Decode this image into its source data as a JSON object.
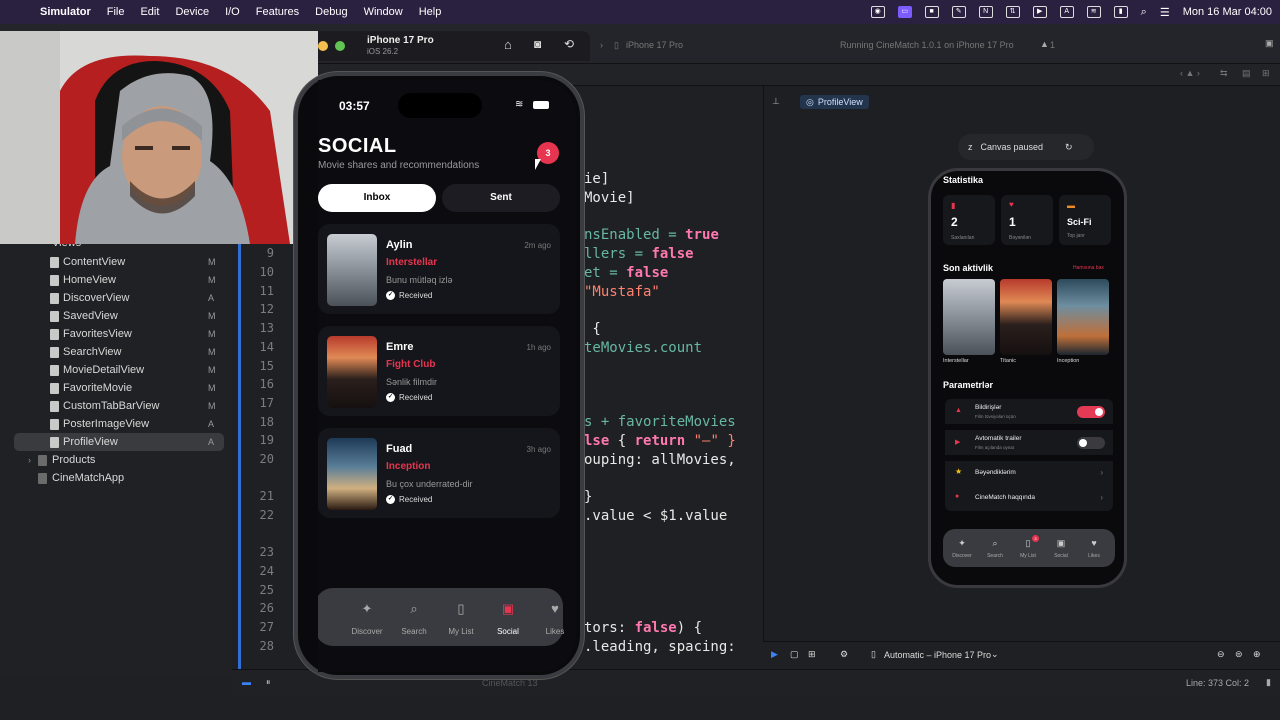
{
  "menubar": {
    "app": "Simulator",
    "items": [
      "File",
      "Edit",
      "Device",
      "I/O",
      "Features",
      "Debug",
      "Window",
      "Help"
    ],
    "clock": "Mon 16 Mar  04:00"
  },
  "simulator": {
    "device": "iPhone 17 Pro",
    "os": "iOS 26.2"
  },
  "toolbar": {
    "scheme_device": "iPhone 17 Pro",
    "status": "Running CineMatch 1.0.1 on iPhone 17 Pro",
    "warnings": "1"
  },
  "navigator": {
    "group": "Views",
    "files": [
      {
        "name": "ContentView",
        "badge": "M"
      },
      {
        "name": "HomeView",
        "badge": "M"
      },
      {
        "name": "DiscoverView",
        "badge": "A"
      },
      {
        "name": "SavedView",
        "badge": "M"
      },
      {
        "name": "FavoritesView",
        "badge": "M"
      },
      {
        "name": "SearchView",
        "badge": "M"
      },
      {
        "name": "MovieDetailView",
        "badge": "M"
      },
      {
        "name": "FavoriteMovie",
        "badge": "M"
      },
      {
        "name": "CustomTabBarView",
        "badge": "M"
      },
      {
        "name": "PosterImageView",
        "badge": "A"
      },
      {
        "name": "ProfileView",
        "badge": "A"
      }
    ],
    "products": "Products",
    "app_folder": "CineMatchApp"
  },
  "editor": {
    "line_numbers": [
      "9",
      "10",
      "11",
      "12",
      "13",
      "14",
      "15",
      "16",
      "17",
      "18",
      "19",
      "20",
      "21",
      "22",
      "23",
      "24",
      "25",
      "26",
      "27",
      "28"
    ],
    "code": {
      "l1": "ie]",
      "l2": "Movie]",
      "l3a": "nsEnabled = ",
      "l3b": "true",
      "l4a": "llers = ",
      "l4b": "false",
      "l5a": "et = ",
      "l5b": "false",
      "l6": "\"Mustafa\"",
      "l7": " {",
      "l8": "teMovies.count",
      "l9a": "s + ",
      "l9b": "favoriteMovies",
      "l10a": "lse",
      "l10b": " { ",
      "l10c": "return",
      "l10d": " \"—\" }",
      "l11": "ouping: allMovies,",
      "l12": "}",
      "l13": ".value < $1.value",
      "l14a": "tors: ",
      "l14b": "false",
      "l14c": ") {",
      "l15": ".leading, spacing:"
    }
  },
  "canvas": {
    "tab": "ProfileView",
    "paused": "Canvas paused",
    "device_selector": "Automatic – iPhone 17 Pro"
  },
  "status": {
    "position": "Line: 373  Col: 2",
    "target": "CineMatch 13"
  },
  "preview": {
    "stats_title": "Statistika",
    "stats": [
      {
        "value": "2",
        "label": "Saxlanılan"
      },
      {
        "value": "1",
        "label": "Bəyənilən"
      },
      {
        "value": "Sci-Fi",
        "label": "Top janr"
      }
    ],
    "activity_title": "Son aktivlik",
    "activity_link": "Hamısına bax",
    "activity": [
      "Interstellar",
      "Titanic",
      "Inception"
    ],
    "settings_title": "Parametrlər",
    "settings": [
      {
        "title": "Bildirişlər",
        "sub": "Film tövsiyələri üçün",
        "toggle": true
      },
      {
        "title": "Avtomatik trailer",
        "sub": "Film açılanda oynat",
        "toggle": false
      },
      {
        "title": "Bəyəndiklərim"
      },
      {
        "title": "CineMatch haqqında"
      }
    ],
    "tabs": [
      "Discover",
      "Search",
      "My List",
      "Social",
      "Likes"
    ],
    "mylist_badge": "3"
  },
  "phone": {
    "time": "03:57",
    "title": "SOCIAL",
    "subtitle": "Movie shares and recommendations",
    "badge": "3",
    "segments": {
      "inbox": "Inbox",
      "sent": "Sent"
    },
    "messages": [
      {
        "name": "Aylin",
        "time": "2m ago",
        "movie": "Interstellar",
        "note": "Bunu mütləq izlə",
        "status": "Received"
      },
      {
        "name": "Emre",
        "time": "1h ago",
        "movie": "Fight Club",
        "note": "Sənlik filmdir",
        "status": "Received"
      },
      {
        "name": "Fuad",
        "time": "3h ago",
        "movie": "Inception",
        "note": "Bu çox underrated-dir",
        "status": "Received"
      }
    ],
    "tabs": [
      "Discover",
      "Search",
      "My List",
      "Social",
      "Likes"
    ]
  },
  "colors": {
    "accent": "#e8354f",
    "menubar": "#2a2140",
    "xcode_bg": "#1f2023"
  }
}
